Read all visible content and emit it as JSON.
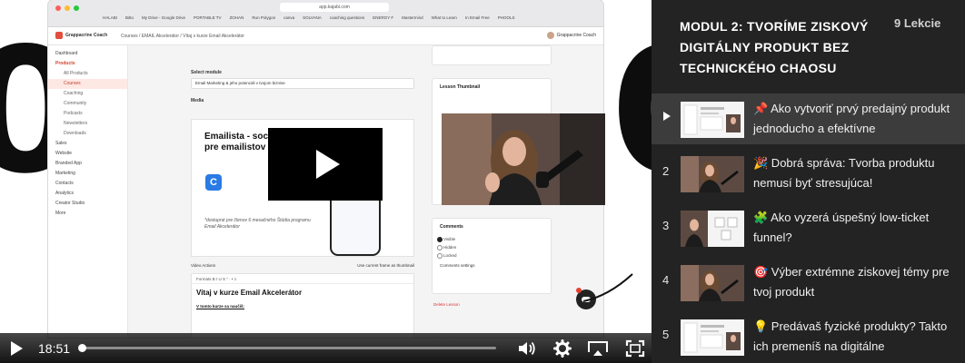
{
  "browser": {
    "url": "app.kajabi.com",
    "bookmarks": [
      "HALABI",
      "Bitto",
      "My Drive - Google Drive",
      "PORTABLE TV",
      "ZOHAN",
      "Run Polygon",
      "canva",
      "SOLVANA",
      "coaching questions",
      "ENERGY F",
      "Mastermind",
      "What to Learn",
      "In Email Free",
      "PHOOLS"
    ]
  },
  "app": {
    "brand": "Grappacrine Coach",
    "breadcrumbs": "Courses  /  EMAIL Akcelerátor  /  Vítaj v kurze Email Akcelerátor",
    "user": "Grappacrine Coach"
  },
  "sidebar": {
    "items": [
      {
        "label": "Dashboard",
        "kind": "top"
      },
      {
        "label": "Products",
        "kind": "bold"
      },
      {
        "label": "All Products",
        "kind": "sub"
      },
      {
        "label": "Courses",
        "kind": "active"
      },
      {
        "label": "Coaching",
        "kind": "sub"
      },
      {
        "label": "Community",
        "kind": "sub"
      },
      {
        "label": "Podcasts",
        "kind": "sub"
      },
      {
        "label": "Newsletters",
        "kind": "sub"
      },
      {
        "label": "Downloads",
        "kind": "sub"
      },
      {
        "label": "Sales",
        "kind": "top"
      },
      {
        "label": "Website",
        "kind": "top"
      },
      {
        "label": "Branded App",
        "kind": "top"
      },
      {
        "label": "Marketing",
        "kind": "top"
      },
      {
        "label": "Contacts",
        "kind": "top"
      },
      {
        "label": "Analytics",
        "kind": "top"
      },
      {
        "label": "Creator Studio",
        "kind": "top"
      },
      {
        "label": "More",
        "kind": "top"
      }
    ]
  },
  "editor": {
    "select_module_label": "Select module",
    "select_module_value": "Email Marketing & jeho potenciál v tvojom biznise",
    "media_label": "Media",
    "promo_title_line1": "Emailista - sociál",
    "promo_title_line2": "pre emailistov",
    "promo_icon": "C",
    "promo_footnote": "*dostupné pre členov 6 mesačného Štúdia programu Email Akcelerátor",
    "video_actions_label": "Video Actions",
    "use_frame_label": "Use current frame as thumbnail",
    "toolbar": "Formats   B   I   U   S   “   ·   •   ≡",
    "heading": "Vitaj v kurze Email Akcelerátor",
    "subheading": "V tomto kurze sa naučíš:"
  },
  "right_cards": {
    "thumbnail_title": "Lesson Thumbnail",
    "comments_title": "Comments",
    "comments_options": [
      {
        "label": "Visible",
        "on": true
      },
      {
        "label": "Hidden",
        "on": false
      },
      {
        "label": "Locked",
        "on": false
      }
    ],
    "comments_settings": "Comments settings",
    "delete_lesson": "Delete Lesson"
  },
  "player": {
    "background_digit_left": "0",
    "background_digit_right": "0",
    "current_time": "18:51",
    "progress": 0.0
  },
  "playlist": {
    "module_title": "MODUL 2: TVORÍME ZISKOVÝ DIGITÁLNY PRODUKT BEZ TECHNICKÉHO CHAOSU",
    "lesson_count": "9 Lekcie",
    "items": [
      {
        "number": "",
        "current": true,
        "emoji": "📌",
        "title": "Ako vytvoriť prvý predajný produkt jednoducho a efektívne",
        "thumb": "screen"
      },
      {
        "number": "2",
        "current": false,
        "emoji": "🎉",
        "title": "Dobrá správa: Tvorba produktu nemusí byť stresujúca!",
        "thumb": "person"
      },
      {
        "number": "3",
        "current": false,
        "emoji": "🧩",
        "title": "Ako vyzerá úspešný low-ticket funnel?",
        "thumb": "split"
      },
      {
        "number": "4",
        "current": false,
        "emoji": "🎯",
        "title": "Výber extrémne ziskovej témy pre tvoj produkt",
        "thumb": "person"
      },
      {
        "number": "5",
        "current": false,
        "emoji": "💡",
        "title": "Predávaš fyzické produkty? Takto ich premeníš na digitálne",
        "thumb": "screen"
      }
    ]
  },
  "colors": {
    "accent": "#e34d3d",
    "panel_bg": "#232323",
    "panel_current": "#3c3c3c"
  }
}
